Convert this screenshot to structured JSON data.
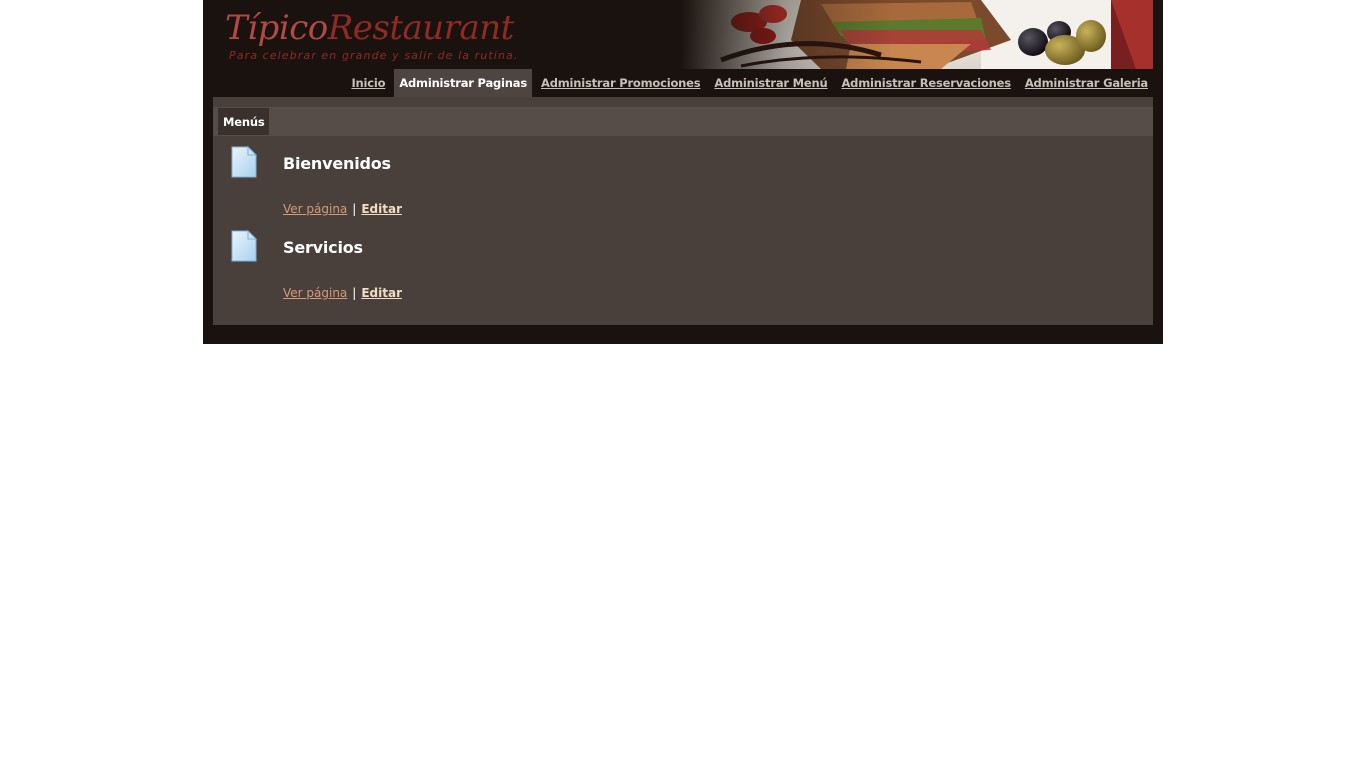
{
  "header": {
    "logo_part1": "Típico",
    "logo_part2": "Restaurant",
    "tagline": "Para celebrar en grande y salir de la rutina."
  },
  "nav": {
    "items": [
      {
        "label": "Inicio",
        "active": false
      },
      {
        "label": "Administrar Paginas",
        "active": true
      },
      {
        "label": "Administrar Promociones",
        "active": false
      },
      {
        "label": "Administrar Menú",
        "active": false
      },
      {
        "label": "Administrar Reservaciones",
        "active": false
      },
      {
        "label": "Administrar Galeria",
        "active": false
      }
    ]
  },
  "subnav": {
    "tab_label": "Menús"
  },
  "pages": [
    {
      "title": "Bienvenidos",
      "view_label": "Ver página",
      "separator": "|",
      "edit_label": "Editar",
      "icon": "document-icon"
    },
    {
      "title": "Servicios",
      "view_label": "Ver página",
      "separator": "|",
      "edit_label": "Editar",
      "icon": "document-icon"
    }
  ],
  "colors": {
    "frame": "#1a120e",
    "content": "#4a403b",
    "subnav": "#574d48",
    "nav_active": "#4f4540",
    "logo_red": "#8f2a25",
    "view_link": "#d49a78",
    "edit_link": "#f0dcc0"
  }
}
